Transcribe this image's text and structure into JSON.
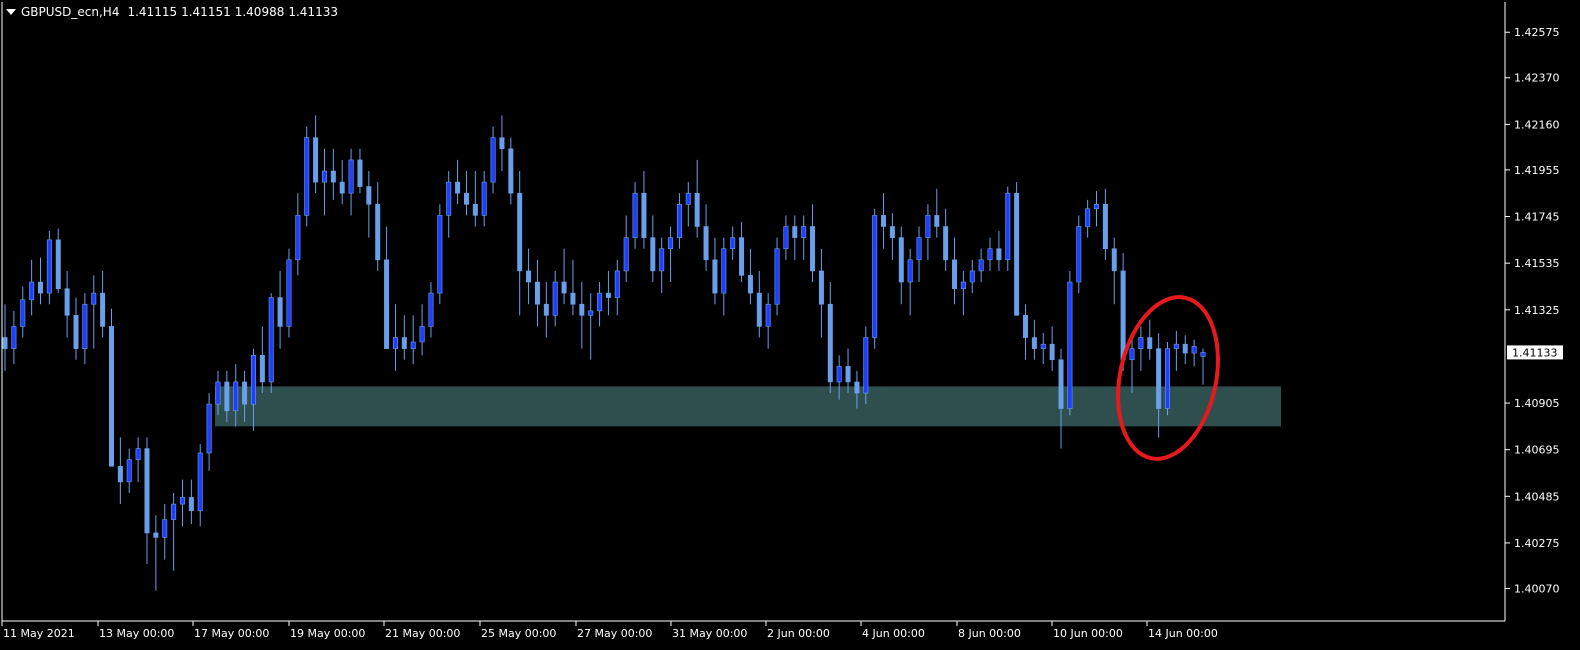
{
  "window": {
    "symbol_label": "GBPUSD_ecn,H4",
    "ohlc": [
      "1.41115",
      "1.41151",
      "1.40988",
      "1.41133"
    ]
  },
  "colors": {
    "background": "#000000",
    "candle_bull": "#1f3fff",
    "candle_bear": "#6a9fea",
    "support_zone": "#2f4f4f",
    "annotation_ellipse": "#e8191c",
    "axis": "#ffffff",
    "current_price_tag_bg": "#ffffff",
    "current_price_tag_text": "#000000"
  },
  "chart_data": {
    "type": "candlestick",
    "timeframe": "H4",
    "x_tick_labels": [
      "11 May 2021",
      "13 May 00:00",
      "17 May 00:00",
      "19 May 00:00",
      "21 May 00:00",
      "25 May 00:00",
      "27 May 00:00",
      "31 May 00:00",
      "2 Jun 00:00",
      "4 Jun 00:00",
      "8 Jun 00:00",
      "10 Jun 00:00",
      "14 Jun 00:00"
    ],
    "y_tick_labels": [
      "1.42575",
      "1.42370",
      "1.42160",
      "1.41955",
      "1.41745",
      "1.41535",
      "1.41325",
      "1.40905",
      "1.40695",
      "1.40485",
      "1.40275",
      "1.40070"
    ],
    "ylim": [
      1.4,
      1.4263
    ],
    "current_price": "1.41133",
    "support_zone": {
      "from": 1.408,
      "to": 1.4098
    },
    "annotation": "ellipse highlighting the most recent candles at the support zone",
    "candles": [
      [
        1.412,
        1.4135,
        1.4105,
        1.4115
      ],
      [
        1.4115,
        1.4132,
        1.4108,
        1.4125
      ],
      [
        1.4125,
        1.4143,
        1.412,
        1.4137
      ],
      [
        1.4137,
        1.4155,
        1.413,
        1.4145
      ],
      [
        1.4145,
        1.4156,
        1.4135,
        1.414
      ],
      [
        1.414,
        1.4168,
        1.4135,
        1.4164
      ],
      [
        1.4164,
        1.4169,
        1.414,
        1.4142
      ],
      [
        1.4142,
        1.415,
        1.412,
        1.413
      ],
      [
        1.413,
        1.4138,
        1.411,
        1.4115
      ],
      [
        1.4115,
        1.414,
        1.4108,
        1.4135
      ],
      [
        1.4135,
        1.4148,
        1.4115,
        1.414
      ],
      [
        1.414,
        1.415,
        1.412,
        1.4125
      ],
      [
        1.4125,
        1.4133,
        1.407,
        1.4062
      ],
      [
        1.4062,
        1.4075,
        1.4045,
        1.4055
      ],
      [
        1.4055,
        1.407,
        1.405,
        1.4065
      ],
      [
        1.4065,
        1.4075,
        1.4055,
        1.407
      ],
      [
        1.407,
        1.4075,
        1.4018,
        1.4032
      ],
      [
        1.4032,
        1.404,
        1.4006,
        1.403
      ],
      [
        1.403,
        1.4045,
        1.402,
        1.4038
      ],
      [
        1.4038,
        1.405,
        1.4015,
        1.4045
      ],
      [
        1.4045,
        1.4056,
        1.4035,
        1.4048
      ],
      [
        1.4048,
        1.4056,
        1.4036,
        1.4042
      ],
      [
        1.4042,
        1.4072,
        1.4035,
        1.4068
      ],
      [
        1.4068,
        1.4095,
        1.406,
        1.409
      ],
      [
        1.409,
        1.4105,
        1.4085,
        1.41
      ],
      [
        1.41,
        1.4105,
        1.4082,
        1.4087
      ],
      [
        1.4087,
        1.4108,
        1.408,
        1.41
      ],
      [
        1.41,
        1.4105,
        1.4082,
        1.409
      ],
      [
        1.409,
        1.4115,
        1.4078,
        1.4112
      ],
      [
        1.4112,
        1.4125,
        1.4095,
        1.41
      ],
      [
        1.41,
        1.414,
        1.4095,
        1.4138
      ],
      [
        1.4138,
        1.415,
        1.4115,
        1.4125
      ],
      [
        1.4125,
        1.416,
        1.412,
        1.4155
      ],
      [
        1.4155,
        1.4185,
        1.4148,
        1.4175
      ],
      [
        1.4175,
        1.4215,
        1.417,
        1.421
      ],
      [
        1.421,
        1.422,
        1.4185,
        1.419
      ],
      [
        1.419,
        1.4205,
        1.4175,
        1.4195
      ],
      [
        1.4195,
        1.4205,
        1.4182,
        1.419
      ],
      [
        1.419,
        1.42,
        1.418,
        1.4185
      ],
      [
        1.4185,
        1.4205,
        1.4175,
        1.42
      ],
      [
        1.42,
        1.4205,
        1.4185,
        1.4188
      ],
      [
        1.4188,
        1.4195,
        1.4165,
        1.418
      ],
      [
        1.418,
        1.419,
        1.415,
        1.4155
      ],
      [
        1.4155,
        1.417,
        1.4115,
        1.4115
      ],
      [
        1.4115,
        1.4135,
        1.4105,
        1.412
      ],
      [
        1.412,
        1.413,
        1.411,
        1.4115
      ],
      [
        1.4115,
        1.413,
        1.4108,
        1.4118
      ],
      [
        1.4118,
        1.4135,
        1.4112,
        1.4125
      ],
      [
        1.4125,
        1.4145,
        1.412,
        1.414
      ],
      [
        1.414,
        1.418,
        1.4135,
        1.4175
      ],
      [
        1.4175,
        1.4195,
        1.4165,
        1.419
      ],
      [
        1.419,
        1.42,
        1.418,
        1.4185
      ],
      [
        1.4185,
        1.4195,
        1.4175,
        1.418
      ],
      [
        1.418,
        1.4195,
        1.417,
        1.4175
      ],
      [
        1.4175,
        1.4195,
        1.417,
        1.419
      ],
      [
        1.419,
        1.4215,
        1.4185,
        1.421
      ],
      [
        1.421,
        1.422,
        1.4195,
        1.4205
      ],
      [
        1.4205,
        1.421,
        1.418,
        1.4185
      ],
      [
        1.4185,
        1.4195,
        1.413,
        1.415
      ],
      [
        1.415,
        1.416,
        1.4135,
        1.4145
      ],
      [
        1.4145,
        1.4155,
        1.4125,
        1.4135
      ],
      [
        1.4135,
        1.4145,
        1.412,
        1.413
      ],
      [
        1.413,
        1.415,
        1.4125,
        1.4145
      ],
      [
        1.4145,
        1.416,
        1.4135,
        1.414
      ],
      [
        1.414,
        1.4155,
        1.413,
        1.4135
      ],
      [
        1.4135,
        1.4145,
        1.4115,
        1.413
      ],
      [
        1.413,
        1.414,
        1.411,
        1.4132
      ],
      [
        1.4132,
        1.4145,
        1.4125,
        1.414
      ],
      [
        1.414,
        1.415,
        1.413,
        1.4138
      ],
      [
        1.4138,
        1.4155,
        1.413,
        1.415
      ],
      [
        1.415,
        1.4175,
        1.4145,
        1.4165
      ],
      [
        1.4165,
        1.419,
        1.416,
        1.4185
      ],
      [
        1.4185,
        1.4195,
        1.416,
        1.4165
      ],
      [
        1.4165,
        1.4175,
        1.4145,
        1.415
      ],
      [
        1.415,
        1.4165,
        1.414,
        1.416
      ],
      [
        1.416,
        1.417,
        1.4145,
        1.4165
      ],
      [
        1.4165,
        1.4185,
        1.416,
        1.418
      ],
      [
        1.418,
        1.419,
        1.417,
        1.4185
      ],
      [
        1.4185,
        1.42,
        1.4165,
        1.417
      ],
      [
        1.417,
        1.418,
        1.415,
        1.4155
      ],
      [
        1.4155,
        1.4165,
        1.4135,
        1.414
      ],
      [
        1.414,
        1.4165,
        1.413,
        1.416
      ],
      [
        1.416,
        1.417,
        1.4155,
        1.4165
      ],
      [
        1.4165,
        1.4172,
        1.4145,
        1.4148
      ],
      [
        1.4148,
        1.416,
        1.4135,
        1.414
      ],
      [
        1.414,
        1.415,
        1.412,
        1.4125
      ],
      [
        1.4125,
        1.414,
        1.4115,
        1.4135
      ],
      [
        1.4135,
        1.4165,
        1.413,
        1.416
      ],
      [
        1.416,
        1.4175,
        1.4155,
        1.417
      ],
      [
        1.417,
        1.4175,
        1.4155,
        1.4165
      ],
      [
        1.4165,
        1.4175,
        1.4155,
        1.417
      ],
      [
        1.417,
        1.418,
        1.4145,
        1.415
      ],
      [
        1.415,
        1.416,
        1.412,
        1.4135
      ],
      [
        1.4135,
        1.4145,
        1.4095,
        1.41
      ],
      [
        1.41,
        1.4112,
        1.4092,
        1.4107
      ],
      [
        1.4107,
        1.4115,
        1.4095,
        1.41
      ],
      [
        1.41,
        1.4105,
        1.4088,
        1.4095
      ],
      [
        1.4095,
        1.4125,
        1.409,
        1.412
      ],
      [
        1.412,
        1.4178,
        1.4115,
        1.4175
      ],
      [
        1.4175,
        1.4185,
        1.416,
        1.417
      ],
      [
        1.417,
        1.4176,
        1.4155,
        1.4165
      ],
      [
        1.4165,
        1.417,
        1.4135,
        1.4145
      ],
      [
        1.4145,
        1.416,
        1.413,
        1.4155
      ],
      [
        1.4155,
        1.417,
        1.4145,
        1.4165
      ],
      [
        1.4165,
        1.418,
        1.4155,
        1.4175
      ],
      [
        1.4175,
        1.4187,
        1.4165,
        1.417
      ],
      [
        1.417,
        1.4178,
        1.415,
        1.4155
      ],
      [
        1.4155,
        1.4165,
        1.4135,
        1.4142
      ],
      [
        1.4142,
        1.415,
        1.413,
        1.4145
      ],
      [
        1.4145,
        1.4155,
        1.414,
        1.415
      ],
      [
        1.415,
        1.416,
        1.4145,
        1.4155
      ],
      [
        1.4155,
        1.4165,
        1.415,
        1.416
      ],
      [
        1.416,
        1.4168,
        1.415,
        1.4155
      ],
      [
        1.4155,
        1.4188,
        1.415,
        1.4185
      ],
      [
        1.4185,
        1.419,
        1.414,
        1.413
      ],
      [
        1.413,
        1.4135,
        1.411,
        1.412
      ],
      [
        1.412,
        1.4128,
        1.411,
        1.4115
      ],
      [
        1.4115,
        1.4122,
        1.4108,
        1.4117
      ],
      [
        1.4117,
        1.4125,
        1.4105,
        1.411
      ],
      [
        1.411,
        1.4115,
        1.407,
        1.4088
      ],
      [
        1.4088,
        1.415,
        1.4085,
        1.4145
      ],
      [
        1.4145,
        1.4175,
        1.414,
        1.417
      ],
      [
        1.417,
        1.4182,
        1.4165,
        1.4178
      ],
      [
        1.4178,
        1.4186,
        1.417,
        1.418
      ],
      [
        1.418,
        1.4187,
        1.4155,
        1.416
      ],
      [
        1.416,
        1.4165,
        1.4135,
        1.415
      ],
      [
        1.415,
        1.4158,
        1.4105,
        1.411
      ],
      [
        1.411,
        1.412,
        1.4095,
        1.4115
      ],
      [
        1.4115,
        1.4125,
        1.4105,
        1.412
      ],
      [
        1.412,
        1.4128,
        1.411,
        1.4115
      ],
      [
        1.4115,
        1.4122,
        1.4075,
        1.4088
      ],
      [
        1.4088,
        1.4118,
        1.4085,
        1.4115
      ],
      [
        1.4115,
        1.4123,
        1.4105,
        1.4117
      ],
      [
        1.4117,
        1.4121,
        1.4108,
        1.4113
      ],
      [
        1.4113,
        1.4119,
        1.4107,
        1.4116
      ],
      [
        1.41115,
        1.41151,
        1.40988,
        1.41133
      ]
    ]
  }
}
